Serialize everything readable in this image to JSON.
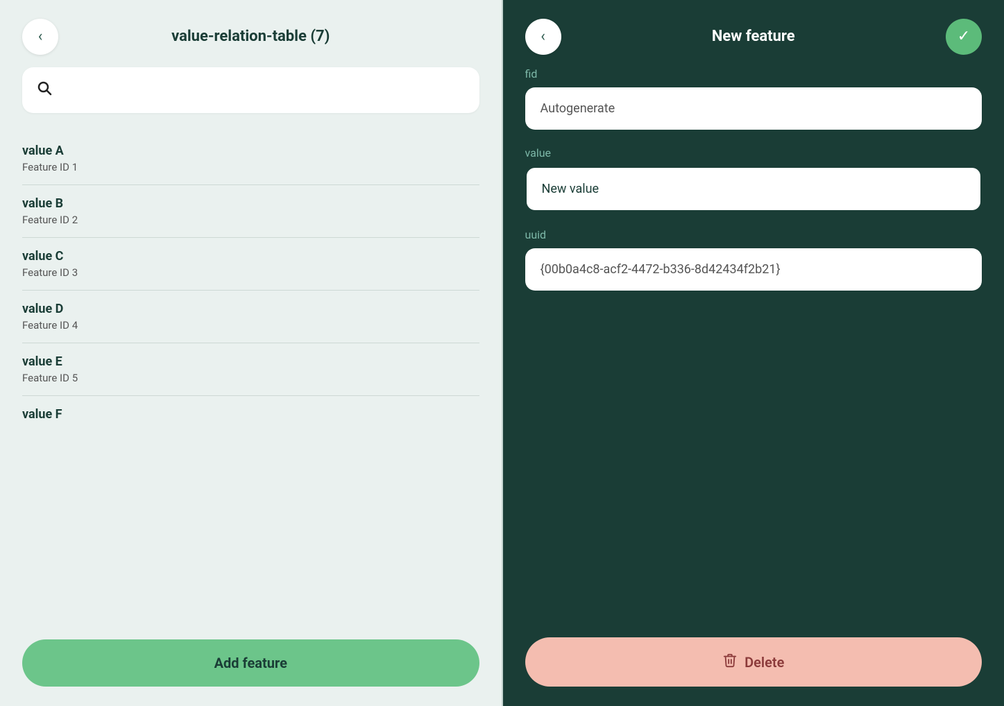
{
  "left_panel": {
    "title": "value-relation-table (7)",
    "back_label": "<",
    "search": {
      "placeholder": ""
    },
    "items": [
      {
        "title": "value A",
        "subtitle": "Feature ID 1"
      },
      {
        "title": "value B",
        "subtitle": "Feature ID 2"
      },
      {
        "title": "value C",
        "subtitle": "Feature ID 3"
      },
      {
        "title": "value D",
        "subtitle": "Feature ID 4"
      },
      {
        "title": "value E",
        "subtitle": "Feature ID 5"
      },
      {
        "title": "value F",
        "subtitle": ""
      }
    ],
    "add_button": "Add feature"
  },
  "right_panel": {
    "title": "New feature",
    "back_label": "<",
    "confirm_icon": "✓",
    "fields": [
      {
        "label": "fid",
        "value": "Autogenerate",
        "active": false
      },
      {
        "label": "value",
        "value": "New value",
        "active": true
      },
      {
        "label": "uuid",
        "value": "{00b0a4c8-acf2-4472-b336-8d42434f2b21}",
        "active": false
      }
    ],
    "delete_button": "Delete",
    "trash_icon": "🗑"
  }
}
